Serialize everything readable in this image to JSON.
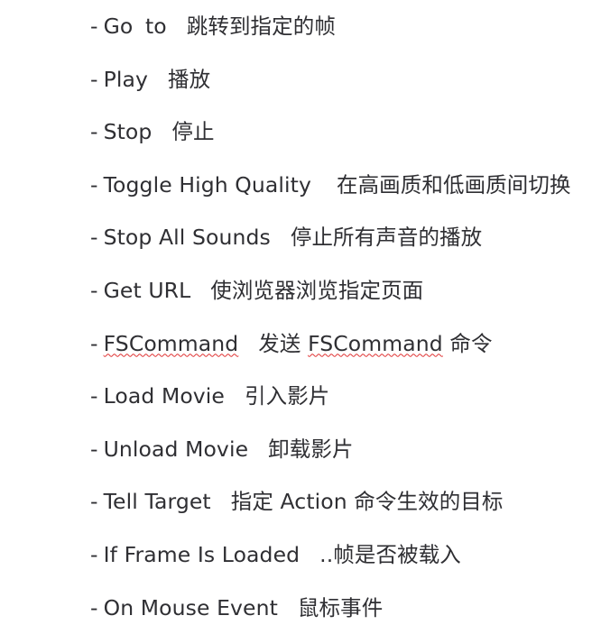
{
  "document": {
    "background_color": "#ffffff",
    "text_color": "#2f2f33",
    "spellcheck_underline_color": "#e03131",
    "bullet_marker": "-"
  },
  "lines": [
    {
      "marker": "-",
      "term": "Go to",
      "gloss": "跳转到指定的帧",
      "misspelled": false,
      "gap": "gap-md",
      "wide_word_gap": true
    },
    {
      "marker": "-",
      "term": "Play",
      "gloss": "播放",
      "misspelled": false,
      "gap": "gap-md",
      "wide_word_gap": false
    },
    {
      "marker": "-",
      "term": "Stop",
      "gloss": "停止",
      "misspelled": false,
      "gap": "gap-md",
      "wide_word_gap": false
    },
    {
      "marker": "-",
      "term": "Toggle High Quality",
      "gloss": "在高画质和低画质间切换",
      "misspelled": false,
      "gap": "gap-lg",
      "wide_word_gap": false
    },
    {
      "marker": "-",
      "term": "Stop All Sounds",
      "gloss": "停止所有声音的播放",
      "misspelled": false,
      "gap": "gap-md",
      "wide_word_gap": false
    },
    {
      "marker": "-",
      "term": "Get URL",
      "gloss": "使浏览器浏览指定页面",
      "misspelled": false,
      "gap": "gap-md",
      "wide_word_gap": false
    },
    {
      "marker": "-",
      "term": "FSCommand",
      "gloss": "发送 FSCommand 命令",
      "gloss_prefix": "发送 ",
      "gloss_latin": "FSCommand",
      "gloss_suffix": " 命令",
      "misspelled": true,
      "gloss_latin_misspelled": true,
      "gap": "gap-md",
      "wide_word_gap": false
    },
    {
      "marker": "-",
      "term": "Load Movie",
      "gloss": "引入影片",
      "misspelled": false,
      "gap": "gap-md",
      "wide_word_gap": false
    },
    {
      "marker": "-",
      "term": "Unload Movie",
      "gloss": "卸载影片",
      "misspelled": false,
      "gap": "gap-md",
      "wide_word_gap": false
    },
    {
      "marker": "-",
      "term": "Tell Target",
      "gloss": "指定 Action 命令生效的目标",
      "gloss_prefix": "指定 ",
      "gloss_latin": "Action",
      "gloss_suffix": " 命令生效的目标",
      "misspelled": false,
      "gloss_latin_misspelled": false,
      "gap": "gap-md",
      "wide_word_gap": false
    },
    {
      "marker": "-",
      "term": "If Frame Is Loaded",
      "gloss": "..帧是否被载入",
      "misspelled": false,
      "gap": "gap-md",
      "wide_word_gap": false
    },
    {
      "marker": "-",
      "term": "On Mouse Event",
      "gloss": "鼠标事件",
      "misspelled": false,
      "gap": "gap-md",
      "wide_word_gap": false
    }
  ]
}
